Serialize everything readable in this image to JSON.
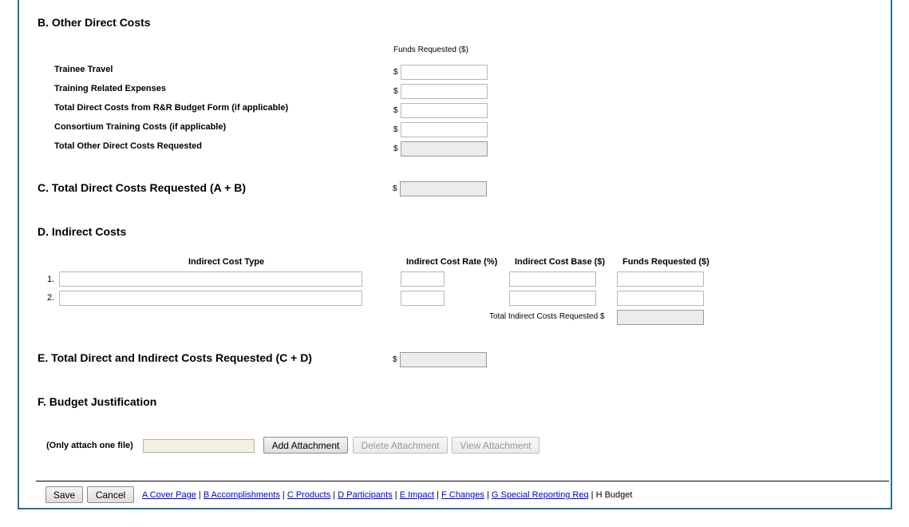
{
  "section_b": {
    "title": "B. Other Direct Costs",
    "funds_header": "Funds Requested ($)",
    "rows": [
      {
        "label": "Trainee Travel",
        "value": "",
        "readonly": false
      },
      {
        "label": "Training Related Expenses",
        "value": "",
        "readonly": false
      },
      {
        "label": "Total Direct Costs from R&R Budget Form (if applicable)",
        "value": "",
        "readonly": false
      },
      {
        "label": "Consortium Training Costs (if applicable)",
        "value": "",
        "readonly": false
      },
      {
        "label": "Total Other Direct Costs Requested",
        "value": "",
        "readonly": true
      }
    ]
  },
  "currency_symbol": "$",
  "section_c": {
    "title": "C. Total Direct Costs Requested (A + B)",
    "value": ""
  },
  "section_d": {
    "title": "D. Indirect Costs",
    "headers": {
      "type": "Indirect Cost Type",
      "rate": "Indirect Cost Rate (%)",
      "base": "Indirect Cost Base ($)",
      "funds": "Funds Requested ($)"
    },
    "rows": [
      {
        "num": "1.",
        "type": "",
        "rate": "",
        "base": "",
        "funds": ""
      },
      {
        "num": "2.",
        "type": "",
        "rate": "",
        "base": "",
        "funds": ""
      }
    ],
    "total_label": "Total Indirect Costs Requested $",
    "total_value": ""
  },
  "section_e": {
    "title": "E. Total Direct and Indirect Costs Requested (C + D)",
    "value": ""
  },
  "section_f": {
    "title": "F. Budget Justification",
    "attach_note": "(Only attach one file)",
    "file_value": "",
    "add_label": "Add Attachment",
    "delete_label": "Delete Attachment",
    "view_label": "View Attachment"
  },
  "footer": {
    "save_label": "Save",
    "cancel_label": "Cancel",
    "nav": [
      {
        "label": "A Cover Page",
        "link": true
      },
      {
        "label": "B Accomplishments",
        "link": true
      },
      {
        "label": "C Products",
        "link": true
      },
      {
        "label": "D Participants",
        "link": true
      },
      {
        "label": "E Impact",
        "link": true
      },
      {
        "label": "F Changes",
        "link": true
      },
      {
        "label": "G Special Reporting Req",
        "link": true
      },
      {
        "label": "H Budget",
        "link": false
      }
    ]
  },
  "colors": {
    "frame_border": "#2c6e94",
    "link": "#0000cc",
    "readonly_bg": "#ececec",
    "file_bg": "#f3efe2"
  }
}
